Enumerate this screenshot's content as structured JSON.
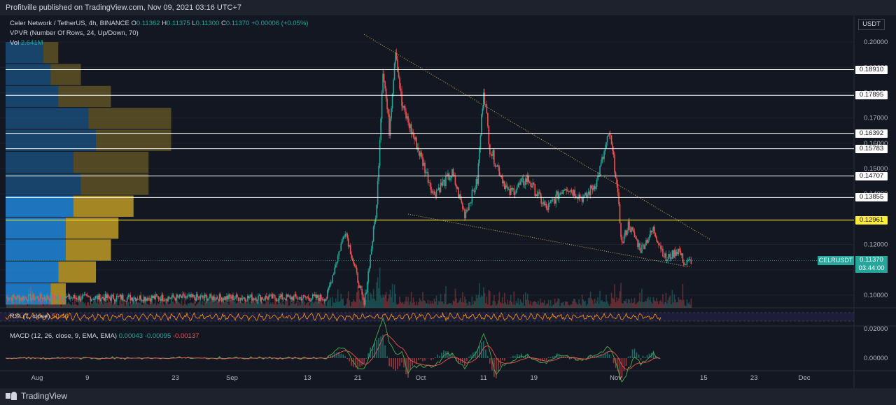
{
  "header": {
    "published_text": "Profitville published on TradingView.com, Nov 09, 2021 03:16 UTC+7"
  },
  "legend": {
    "symbol": "Celer Network / TetherUS, 4h, BINANCE",
    "o_label": "O",
    "o_value": "0.11362",
    "h_label": "H",
    "h_value": "0.11375",
    "l_label": "L",
    "l_value": "0.11300",
    "c_label": "C",
    "c_value": "0.11370",
    "change": "+0.00006 (+0.05%)",
    "vpvr": "VPVR (Number Of Rows, 24, Up/Down, 70)",
    "vol_label": "Vol",
    "vol_value": "2.641M",
    "rsi_label": "RSI (7, close)",
    "rsi_value": "50.46",
    "macd_label": "MACD (12, 26, close, 9, EMA, EMA)",
    "macd_hist": "0.00043",
    "macd_line": "-0.00095",
    "macd_signal": "-0.00137"
  },
  "price_axis": {
    "currency": "USDT",
    "ticks": [
      "0.20000",
      "0.19000",
      "0.18000",
      "0.17000",
      "0.16000",
      "0.15000",
      "0.14000",
      "0.13000",
      "0.12000",
      "0.11000",
      "0.10000"
    ]
  },
  "macd_axis": {
    "ticks": [
      "0.02000",
      "0.00000"
    ]
  },
  "time_axis": {
    "ticks": [
      "Aug",
      "9",
      "23",
      "Sep",
      "13",
      "21",
      "Oct",
      "11",
      "19",
      "Nov",
      "15",
      "23",
      "Dec"
    ]
  },
  "levels": [
    {
      "value": 0.1891,
      "label": "0.18910",
      "color": "#ffffff"
    },
    {
      "value": 0.17895,
      "label": "0.17895",
      "color": "#ffffff"
    },
    {
      "value": 0.16392,
      "label": "0.16392",
      "color": "#ffffff"
    },
    {
      "value": 0.15783,
      "label": "0.15783",
      "color": "#ffffff"
    },
    {
      "value": 0.14707,
      "label": "0.14707",
      "color": "#ffffff"
    },
    {
      "value": 0.13855,
      "label": "0.13855",
      "color": "#ffffff"
    },
    {
      "value": 0.12961,
      "label": "0.12961",
      "color": "#ffeb3b"
    }
  ],
  "current": {
    "ticker": "CELRUSDT",
    "price": "0.11370",
    "countdown": "03:44:00",
    "color": "#26a69a"
  },
  "colors": {
    "background": "#131722",
    "up": "#26a69a",
    "down": "#ef5350",
    "rsi": "#ff9800",
    "macd": "#4caf50",
    "signal": "#ef5350",
    "vpvr_up_light": "#2196f3",
    "vpvr_down_light": "#c9a227",
    "trendline": "#c8b45a"
  },
  "branding": {
    "logo_text": "TradingView"
  },
  "chart_data": {
    "type": "candlestick",
    "timeframe": "4h",
    "y_range": [
      0.095,
      0.205
    ],
    "x_range": [
      "2021-07-27",
      "2021-12-08"
    ],
    "close_path": [
      {
        "x": "2021-08-17",
        "y": 0.099
      },
      {
        "x": "2021-09-16",
        "y": 0.099
      },
      {
        "x": "2021-09-19",
        "y": 0.126
      },
      {
        "x": "2021-09-22",
        "y": 0.096
      },
      {
        "x": "2021-09-24",
        "y": 0.135
      },
      {
        "x": "2021-09-25",
        "y": 0.19
      },
      {
        "x": "2021-09-26",
        "y": 0.165
      },
      {
        "x": "2021-09-27",
        "y": 0.198
      },
      {
        "x": "2021-09-28",
        "y": 0.175
      },
      {
        "x": "2021-10-01",
        "y": 0.155
      },
      {
        "x": "2021-10-03",
        "y": 0.14
      },
      {
        "x": "2021-10-06",
        "y": 0.148
      },
      {
        "x": "2021-10-08",
        "y": 0.132
      },
      {
        "x": "2021-10-10",
        "y": 0.145
      },
      {
        "x": "2021-10-11",
        "y": 0.182
      },
      {
        "x": "2021-10-12",
        "y": 0.158
      },
      {
        "x": "2021-10-15",
        "y": 0.14
      },
      {
        "x": "2021-10-18",
        "y": 0.146
      },
      {
        "x": "2021-10-21",
        "y": 0.134
      },
      {
        "x": "2021-10-24",
        "y": 0.143
      },
      {
        "x": "2021-10-27",
        "y": 0.138
      },
      {
        "x": "2021-10-29",
        "y": 0.145
      },
      {
        "x": "2021-10-31",
        "y": 0.164
      },
      {
        "x": "2021-11-01",
        "y": 0.148
      },
      {
        "x": "2021-11-02",
        "y": 0.12
      },
      {
        "x": "2021-11-03",
        "y": 0.128
      },
      {
        "x": "2021-11-05",
        "y": 0.118
      },
      {
        "x": "2021-11-07",
        "y": 0.126
      },
      {
        "x": "2021-11-09",
        "y": 0.114
      },
      {
        "x": "2021-11-11",
        "y": 0.118
      },
      {
        "x": "2021-11-12",
        "y": 0.112
      },
      {
        "x": "2021-11-13",
        "y": 0.1137
      }
    ],
    "trendlines": [
      {
        "from": {
          "x": "2021-09-22",
          "y": 0.203
        },
        "to": {
          "x": "2021-11-16",
          "y": 0.122
        }
      },
      {
        "from": {
          "x": "2021-09-29",
          "y": 0.132
        },
        "to": {
          "x": "2021-11-13",
          "y": 0.111
        }
      }
    ],
    "volume_profile": [
      {
        "up": 0.3,
        "down": 0.1
      },
      {
        "up": 0.35,
        "down": 0.25
      },
      {
        "up": 0.4,
        "down": 0.3
      },
      {
        "up": 0.4,
        "down": 0.35
      },
      {
        "up": 0.45,
        "down": 0.4
      },
      {
        "up": 0.5,
        "down": 0.45
      },
      {
        "up": 0.45,
        "down": 0.5
      },
      {
        "up": 0.6,
        "down": 0.5
      },
      {
        "up": 0.55,
        "down": 0.55
      },
      {
        "up": 0.35,
        "down": 0.35
      },
      {
        "up": 0.3,
        "down": 0.2
      },
      {
        "up": 0.25,
        "down": 0.1
      }
    ]
  }
}
